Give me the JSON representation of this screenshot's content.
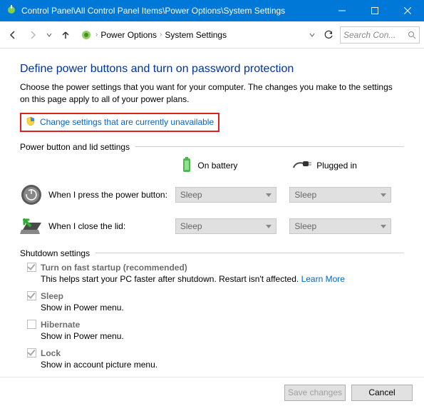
{
  "titlebar": {
    "title": "Control Panel\\All Control Panel Items\\Power Options\\System Settings"
  },
  "nav": {
    "breadcrumb": [
      "Power Options",
      "System Settings"
    ],
    "search_placeholder": "Search Con..."
  },
  "main": {
    "heading": "Define power buttons and turn on password protection",
    "description": "Choose the power settings that you want for your computer. The changes you make to the settings on this page apply to all of your power plans.",
    "change_link": "Change settings that are currently unavailable"
  },
  "power_button_section": {
    "header": "Power button and lid settings",
    "col_battery": "On battery",
    "col_plugged": "Plugged in",
    "rows": [
      {
        "label": "When I press the power button:",
        "battery": "Sleep",
        "plugged": "Sleep"
      },
      {
        "label": "When I close the lid:",
        "battery": "Sleep",
        "plugged": "Sleep"
      }
    ]
  },
  "shutdown_section": {
    "header": "Shutdown settings",
    "items": [
      {
        "label": "Turn on fast startup (recommended)",
        "checked": true,
        "desc": "This helps start your PC faster after shutdown. Restart isn't affected.",
        "learn_more": "Learn More"
      },
      {
        "label": "Sleep",
        "checked": true,
        "desc": "Show in Power menu."
      },
      {
        "label": "Hibernate",
        "checked": false,
        "desc": "Show in Power menu."
      },
      {
        "label": "Lock",
        "checked": true,
        "desc": "Show in account picture menu."
      }
    ]
  },
  "footer": {
    "save": "Save changes",
    "cancel": "Cancel"
  }
}
